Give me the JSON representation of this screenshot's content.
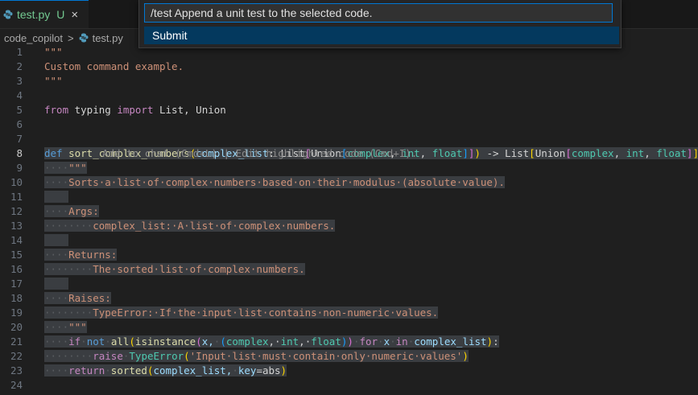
{
  "tab": {
    "filename": "test.py",
    "badge": "U",
    "close_glyph": "×",
    "status_color": "#73c991"
  },
  "breadcrumb": {
    "folder": "code_copilot",
    "separator": ">",
    "file": "test.py"
  },
  "command_palette": {
    "input_value": "/test Append a unit test to the selected code.",
    "submit_label": "Submit"
  },
  "editor": {
    "active_line": 8,
    "inline_hint": "Add to chat (Cmd+L) | Edit highlighted code (Cmd+I).",
    "lines": [
      {
        "n": "1",
        "segs": [
          {
            "t": "\"\"\"",
            "c": "str"
          }
        ]
      },
      {
        "n": "2",
        "segs": [
          {
            "t": "Custom command example.",
            "c": "str"
          }
        ]
      },
      {
        "n": "3",
        "segs": [
          {
            "t": "\"\"\"",
            "c": "str"
          }
        ]
      },
      {
        "n": "4",
        "segs": []
      },
      {
        "n": "5",
        "segs": [
          {
            "t": "from",
            "c": "kw"
          },
          {
            "t": " typing ",
            "c": ""
          },
          {
            "t": "import",
            "c": "kw"
          },
          {
            "t": " List, Union",
            "c": ""
          }
        ]
      },
      {
        "n": "6",
        "segs": []
      },
      {
        "n": "7",
        "segs": []
      },
      {
        "n": "8",
        "sel": true,
        "segs": [
          {
            "t": "def",
            "c": "kwb"
          },
          {
            "t": " ",
            "c": ""
          },
          {
            "t": "sort_complex_numbers",
            "c": "fn"
          },
          {
            "t": "(",
            "c": "br1"
          },
          {
            "t": "complex_list",
            "c": "pm"
          },
          {
            "t": ": List",
            "c": ""
          },
          {
            "t": "[",
            "c": "br2"
          },
          {
            "t": "Union",
            "c": ""
          },
          {
            "t": "[",
            "c": "br3"
          },
          {
            "t": "complex",
            "c": "ty"
          },
          {
            "t": ", ",
            "c": ""
          },
          {
            "t": "int",
            "c": "ty"
          },
          {
            "t": ", ",
            "c": ""
          },
          {
            "t": "float",
            "c": "ty"
          },
          {
            "t": "]",
            "c": "br3"
          },
          {
            "t": "]",
            "c": "br2"
          },
          {
            "t": ")",
            "c": "br1"
          },
          {
            "t": " -> List",
            "c": ""
          },
          {
            "t": "[",
            "c": "br1"
          },
          {
            "t": "Union",
            "c": ""
          },
          {
            "t": "[",
            "c": "br2"
          },
          {
            "t": "complex",
            "c": "ty"
          },
          {
            "t": ", ",
            "c": ""
          },
          {
            "t": "int",
            "c": "ty"
          },
          {
            "t": ", ",
            "c": ""
          },
          {
            "t": "float",
            "c": "ty"
          },
          {
            "t": "]",
            "c": "br2"
          },
          {
            "t": "]",
            "c": "br1"
          },
          {
            "t": ":",
            "c": ""
          }
        ]
      },
      {
        "n": "9",
        "sel": true,
        "segs": [
          {
            "t": "····",
            "c": "ws"
          },
          {
            "t": "\"\"\"",
            "c": "str"
          }
        ]
      },
      {
        "n": "10",
        "sel": true,
        "segs": [
          {
            "t": "····",
            "c": "ws"
          },
          {
            "t": "Sorts·a·list·of·complex·numbers·based·on·their·modulus·(absolute·value).",
            "c": "str"
          }
        ]
      },
      {
        "n": "11",
        "sel": true,
        "segs": []
      },
      {
        "n": "12",
        "sel": true,
        "segs": [
          {
            "t": "····",
            "c": "ws"
          },
          {
            "t": "Args:",
            "c": "str"
          }
        ]
      },
      {
        "n": "13",
        "sel": true,
        "segs": [
          {
            "t": "········",
            "c": "ws"
          },
          {
            "t": "complex_list:·A·list·of·complex·numbers.",
            "c": "str"
          }
        ]
      },
      {
        "n": "14",
        "sel": true,
        "segs": []
      },
      {
        "n": "15",
        "sel": true,
        "segs": [
          {
            "t": "····",
            "c": "ws"
          },
          {
            "t": "Returns:",
            "c": "str"
          }
        ]
      },
      {
        "n": "16",
        "sel": true,
        "segs": [
          {
            "t": "········",
            "c": "ws"
          },
          {
            "t": "The·sorted·list·of·complex·numbers.",
            "c": "str"
          }
        ]
      },
      {
        "n": "17",
        "sel": true,
        "segs": []
      },
      {
        "n": "18",
        "sel": true,
        "segs": [
          {
            "t": "····",
            "c": "ws"
          },
          {
            "t": "Raises:",
            "c": "str"
          }
        ]
      },
      {
        "n": "19",
        "sel": true,
        "segs": [
          {
            "t": "········",
            "c": "ws"
          },
          {
            "t": "TypeError:·If·the·input·list·contains·non-numeric·values.",
            "c": "str"
          }
        ]
      },
      {
        "n": "20",
        "sel": true,
        "segs": [
          {
            "t": "····",
            "c": "ws"
          },
          {
            "t": "\"\"\"",
            "c": "str"
          }
        ]
      },
      {
        "n": "21",
        "sel": true,
        "segs": [
          {
            "t": "····",
            "c": "ws"
          },
          {
            "t": "if",
            "c": "kw"
          },
          {
            "t": "·",
            "c": "ws"
          },
          {
            "t": "not",
            "c": "kwb"
          },
          {
            "t": "·",
            "c": "ws"
          },
          {
            "t": "all",
            "c": "fn"
          },
          {
            "t": "(",
            "c": "br1"
          },
          {
            "t": "isinstance",
            "c": "fn"
          },
          {
            "t": "(",
            "c": "br2"
          },
          {
            "t": "x,",
            "c": "pm"
          },
          {
            "t": "·",
            "c": "ws"
          },
          {
            "t": "(",
            "c": "br3"
          },
          {
            "t": "complex",
            "c": "ty"
          },
          {
            "t": ",·",
            "c": ""
          },
          {
            "t": "int",
            "c": "ty"
          },
          {
            "t": ",·",
            "c": ""
          },
          {
            "t": "float",
            "c": "ty"
          },
          {
            "t": ")",
            "c": "br3"
          },
          {
            "t": ")",
            "c": "br2"
          },
          {
            "t": "·",
            "c": "ws"
          },
          {
            "t": "for",
            "c": "kw"
          },
          {
            "t": "·",
            "c": "ws"
          },
          {
            "t": "x",
            "c": "pm"
          },
          {
            "t": "·",
            "c": "ws"
          },
          {
            "t": "in",
            "c": "kw"
          },
          {
            "t": "·",
            "c": "ws"
          },
          {
            "t": "complex_list",
            "c": "pm"
          },
          {
            "t": ")",
            "c": "br1"
          },
          {
            "t": ":",
            "c": ""
          }
        ]
      },
      {
        "n": "22",
        "sel": true,
        "segs": [
          {
            "t": "········",
            "c": "ws"
          },
          {
            "t": "raise",
            "c": "kw"
          },
          {
            "t": "·",
            "c": "ws"
          },
          {
            "t": "TypeError",
            "c": "ty"
          },
          {
            "t": "(",
            "c": "br1"
          },
          {
            "t": "'Input·list·must·contain·only·numeric·values'",
            "c": "str"
          },
          {
            "t": ")",
            "c": "br1"
          }
        ]
      },
      {
        "n": "23",
        "sel": true,
        "segs": [
          {
            "t": "····",
            "c": "ws"
          },
          {
            "t": "return",
            "c": "kw"
          },
          {
            "t": "·",
            "c": "ws"
          },
          {
            "t": "sorted",
            "c": "fn"
          },
          {
            "t": "(",
            "c": "br1"
          },
          {
            "t": "complex_list,",
            "c": "pm"
          },
          {
            "t": "·",
            "c": "ws"
          },
          {
            "t": "key",
            "c": "pm"
          },
          {
            "t": "=abs",
            "c": ""
          },
          {
            "t": ")",
            "c": "br1"
          }
        ]
      },
      {
        "n": "24",
        "segs": []
      }
    ]
  }
}
